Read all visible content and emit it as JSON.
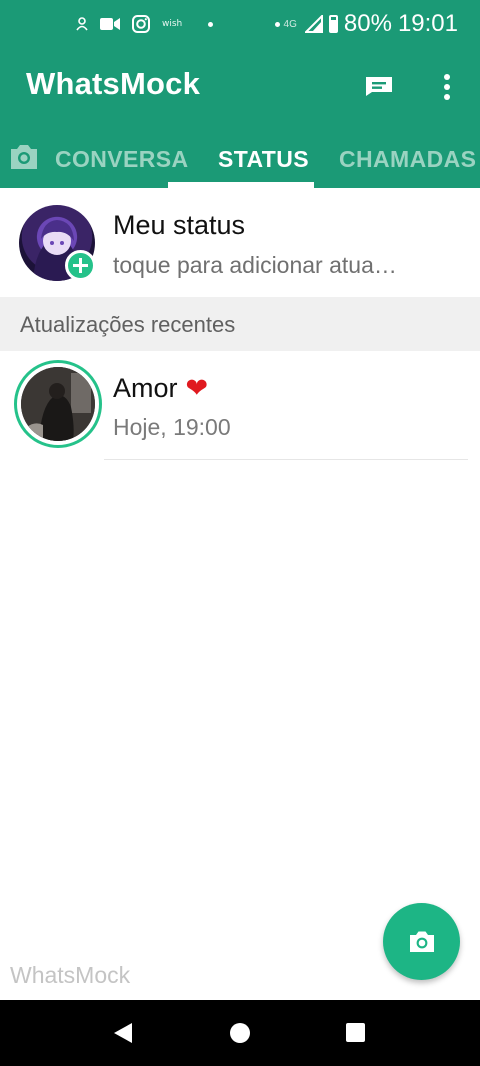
{
  "status_bar": {
    "small_label": "wish",
    "network": "4G",
    "battery": "80%",
    "time": "19:01"
  },
  "app_bar": {
    "title": "WhatsMock"
  },
  "tabs": [
    {
      "label": "CONVERSA",
      "selected": false
    },
    {
      "label": "STATUS",
      "selected": true
    },
    {
      "label": "CHAMADAS",
      "selected": false
    }
  ],
  "my_status": {
    "name": "Meu status",
    "subtitle": "toque para adicionar atua…"
  },
  "recent": {
    "header": "Atualizações recentes",
    "items": [
      {
        "name": "Amor",
        "emoji": "❤",
        "time": "Hoje, 19:00"
      }
    ]
  },
  "watermark": "WhatsMock",
  "colors": {
    "primary": "#1b9a76",
    "accent": "#25c28a",
    "fab": "#1db585"
  }
}
